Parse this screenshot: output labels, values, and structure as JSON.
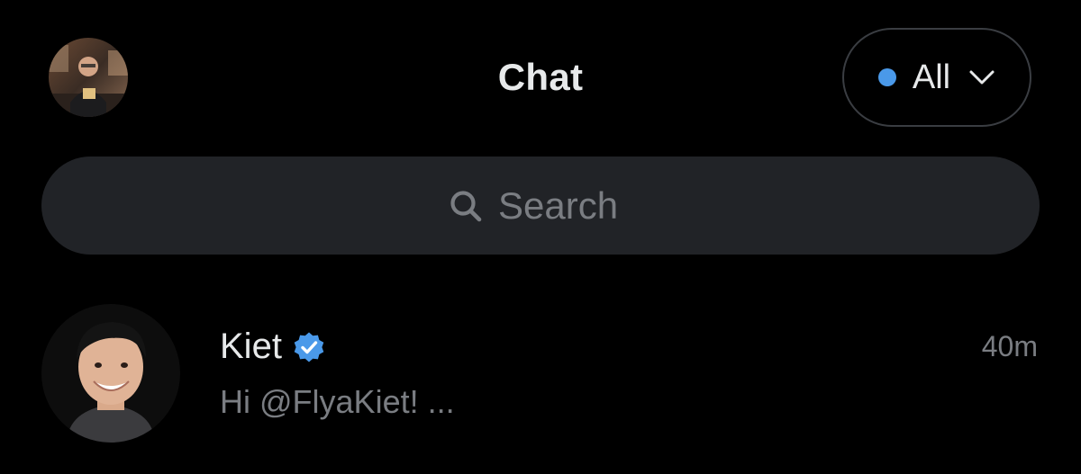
{
  "header": {
    "title": "Chat",
    "avatar_icon": "user-avatar",
    "filter": {
      "label": "All",
      "dot_color": "#4a99e9",
      "icon": "chevron-down-icon"
    }
  },
  "search": {
    "placeholder": "Search",
    "icon": "search-icon"
  },
  "conversations": [
    {
      "name": "Kiet",
      "verified": true,
      "verified_color": "#4a99e9",
      "time": "40m",
      "preview": "Hi @FlyaKiet!  ..."
    }
  ],
  "colors": {
    "background": "#000000",
    "search_background": "#212327",
    "primary_text": "#e7e9ea",
    "secondary_text": "#7a7d82",
    "accent": "#4a99e9"
  }
}
